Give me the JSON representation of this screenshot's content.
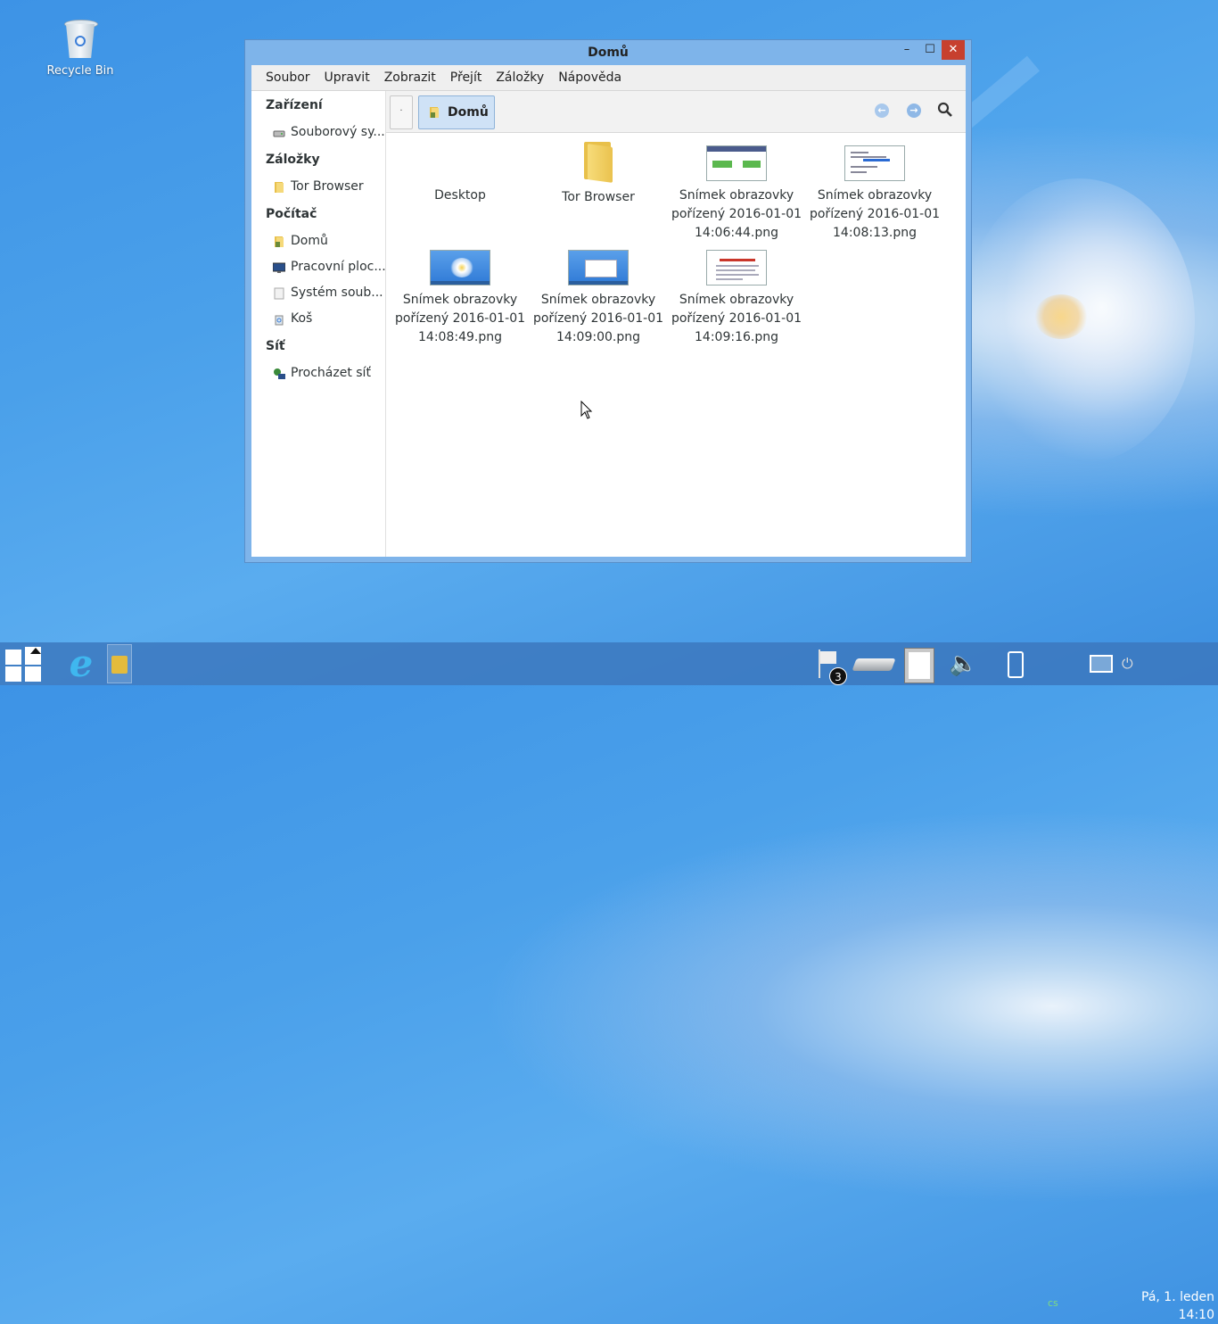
{
  "desktop": {
    "icons": [
      {
        "label": "Recycle Bin",
        "icon": "recycle-bin-icon"
      }
    ]
  },
  "window": {
    "title": "Domů",
    "controls": {
      "minimize": "–",
      "maximize": "☐",
      "close": "✕"
    }
  },
  "menubar": {
    "items": [
      "Soubor",
      "Upravit",
      "Zobrazit",
      "Přejít",
      "Záložky",
      "Nápověda"
    ]
  },
  "sidebar": {
    "sections": [
      {
        "heading": "Zařízení",
        "items": [
          {
            "label": "Souborový sy...",
            "icon": "drive-icon"
          }
        ]
      },
      {
        "heading": "Záložky",
        "items": [
          {
            "label": "Tor Browser",
            "icon": "folder-icon"
          }
        ]
      },
      {
        "heading": "Počítač",
        "items": [
          {
            "label": "Domů",
            "icon": "home-folder-icon"
          },
          {
            "label": "Pracovní ploc...",
            "icon": "desktop-icon"
          },
          {
            "label": "Systém soub...",
            "icon": "filesystem-icon"
          },
          {
            "label": "Koš",
            "icon": "trash-icon"
          }
        ]
      },
      {
        "heading": "Síť",
        "items": [
          {
            "label": "Procházet síť",
            "icon": "network-icon"
          }
        ]
      }
    ]
  },
  "toolbar": {
    "small_button": "·",
    "path": "Domů",
    "back": "←",
    "forward": "→",
    "search_icon": "search-icon"
  },
  "files": [
    {
      "name": "Desktop",
      "type": "folder-hidden"
    },
    {
      "name": "Tor Browser",
      "type": "folder"
    },
    {
      "name": "Snímek obrazovky pořízený 2016-01-01 14:06:44.png",
      "type": "web"
    },
    {
      "name": "Snímek obrazovky pořízený 2016-01-01 14:08:13.png",
      "type": "doc"
    },
    {
      "name": "Snímek obrazovky pořízený 2016-01-01 14:08:49.png",
      "type": "desk"
    },
    {
      "name": "Snímek obrazovky pořízený 2016-01-01 14:09:00.png",
      "type": "desk"
    },
    {
      "name": "Snímek obrazovky pořízený 2016-01-01 14:09:16.png",
      "type": "pdf"
    }
  ],
  "taskbar": {
    "notification_count": "3",
    "language": "cs",
    "clock": {
      "line1": "Pá,  1. leden",
      "line2": "14:10"
    }
  },
  "colors": {
    "accent": "#7eb4ea",
    "close_button": "#c7402e",
    "path_button": "#cfe2f6"
  }
}
